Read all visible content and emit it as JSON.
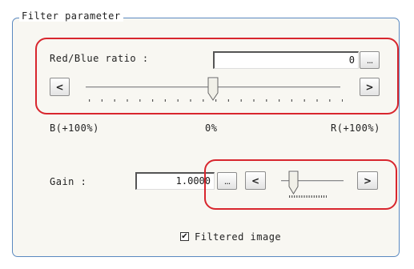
{
  "group": {
    "title": "Filter parameter"
  },
  "red_blue": {
    "label": "Red/Blue ratio :",
    "value": "0",
    "browse_button": "...",
    "left_button": "<",
    "right_button": ">",
    "slider_fraction": 0.5,
    "scale_left": "B(+100%)",
    "scale_center": "0%",
    "scale_right": "R(+100%)"
  },
  "gain": {
    "label": "Gain :",
    "value": "1.0000",
    "browse_button": "...",
    "left_button": "<",
    "right_button": ">",
    "slider_fraction": 0.2
  },
  "filtered_image": {
    "label": "Filtered image",
    "checked": true,
    "check_mark": "✔"
  },
  "colors": {
    "frame_border": "#5a89c0",
    "highlight": "#d8262e"
  }
}
